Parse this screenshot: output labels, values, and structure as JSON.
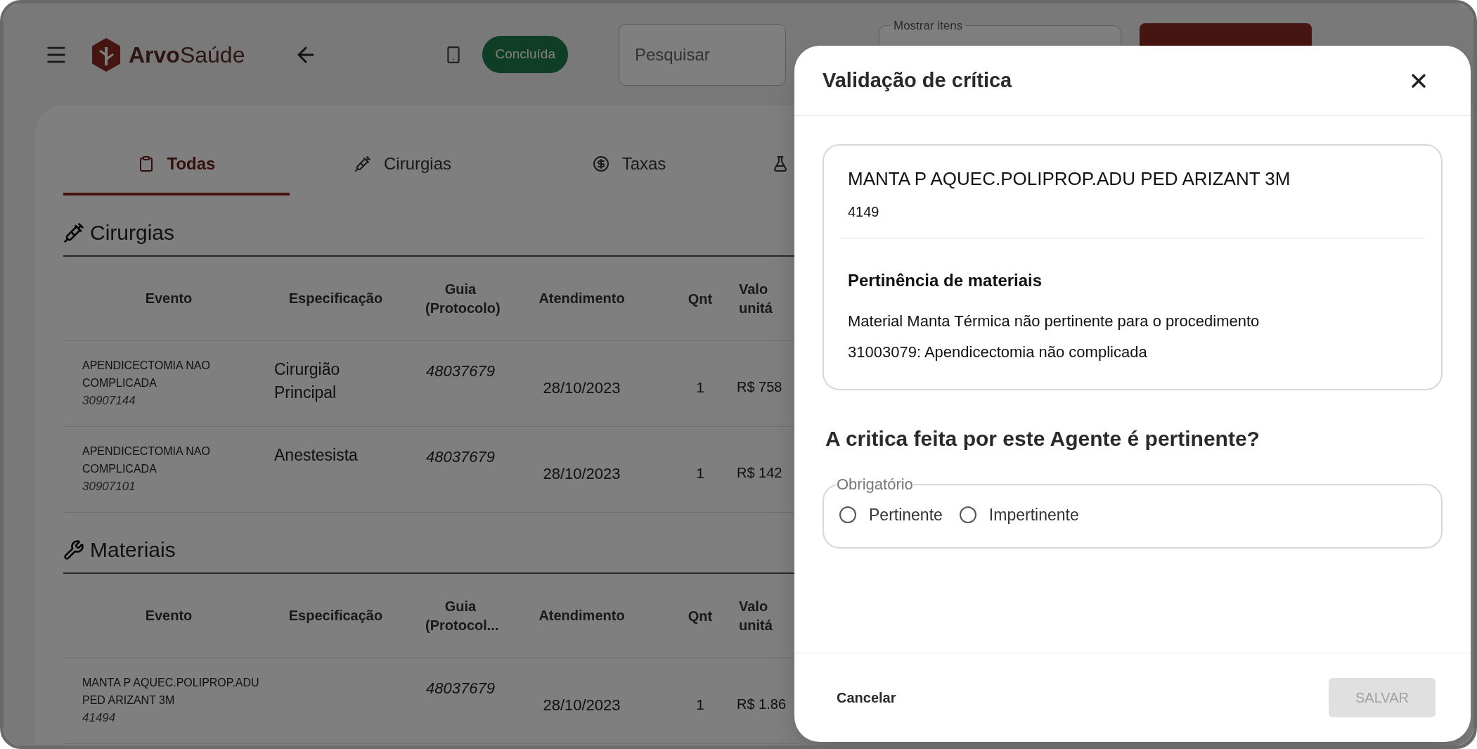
{
  "header": {
    "brand_bold": "Arvo",
    "brand_light": "Saúde",
    "status_badge": "Concluída",
    "search": {
      "placeholder": "Pesquisar"
    },
    "items_select": {
      "label": "Mostrar itens"
    }
  },
  "tabs": [
    {
      "label": "Todas",
      "selected": true
    },
    {
      "label": "Cirurgias",
      "selected": false
    },
    {
      "label": "Taxas",
      "selected": false
    },
    {
      "selected": false
    }
  ],
  "sections": [
    {
      "title": "Cirurgias",
      "columns": [
        "Evento",
        "Especificação",
        "Guia (Protocolo)",
        "Atendimento",
        "Qnt",
        "Valo unitá"
      ],
      "rows": [
        {
          "event": "APENDICECTOMIA NAO COMPLICADA",
          "code": "30907144",
          "specification": "Cirurgião Principal",
          "guide": "48037679",
          "date": "28/10/2023",
          "quantity": "1",
          "unit_value": "R$ 758"
        },
        {
          "event": "APENDICECTOMIA NAO COMPLICADA",
          "code": "30907101",
          "specification": "Anestesista",
          "guide": "48037679",
          "date": "28/10/2023",
          "quantity": "1",
          "unit_value": "R$ 142"
        }
      ]
    },
    {
      "title": "Materiais",
      "columns": [
        "Evento",
        "Especificação",
        "Guia (Protocol...",
        "Atendimento",
        "Qnt",
        "Valo unitá"
      ],
      "rows": [
        {
          "event": "MANTA P AQUEC.POLIPROP.ADU PED ARIZANT 3M",
          "code": "41494",
          "guide": "48037679",
          "date": "28/10/2023",
          "quantity": "1",
          "unit_value": "R$ 1.86"
        }
      ]
    }
  ],
  "dialog": {
    "title": "Validação de crítica",
    "item": {
      "name": "MANTA P AQUEC.POLIPROP.ADU PED ARIZANT 3M",
      "code": "4149",
      "rule_title": "Pertinência de materiais",
      "description": "Material Manta Térmica não pertinente para o procedimento 31003079: Apendicectomia não complicada"
    },
    "question": "A critica feita por este Agente é pertinente?",
    "choice_group": {
      "legend": "Obrigatório",
      "options": [
        {
          "label": "Pertinente",
          "selected": false
        },
        {
          "label": "Impertinente",
          "selected": false
        }
      ]
    },
    "cancel": "Cancelar",
    "save": {
      "label": "SALVAR",
      "disabled": true
    }
  }
}
